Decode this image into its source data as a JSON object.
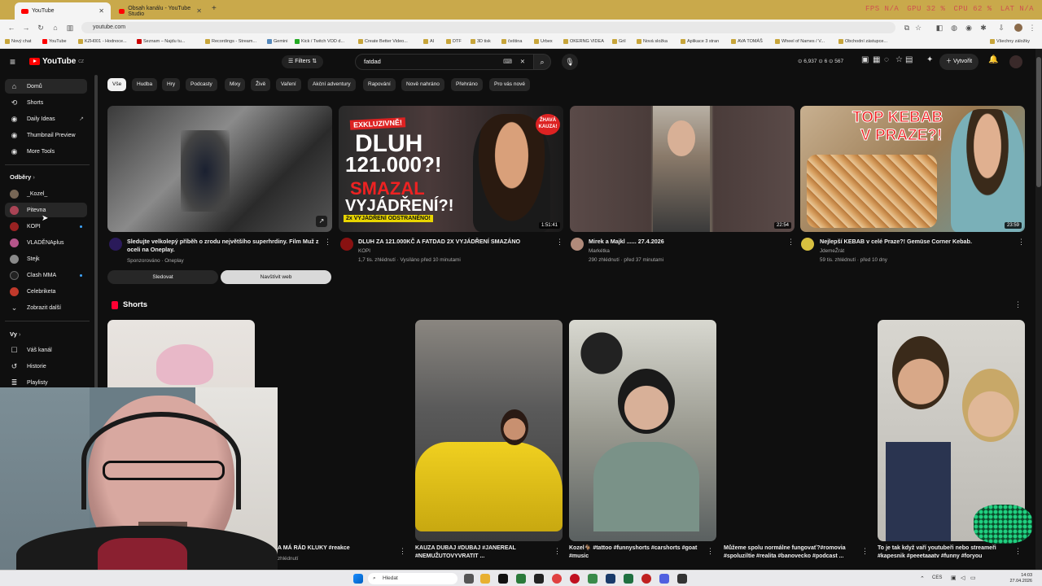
{
  "browser": {
    "tabs": [
      {
        "label": "YouTube",
        "active": true
      },
      {
        "label": "Obsah kanálu - YouTube Studio",
        "active": false
      }
    ],
    "new_tab": "+",
    "sys_stats": [
      "FPS N/A",
      "GPU 32 %",
      "CPU 62 %",
      "LAT N/A"
    ],
    "url": "youtube.com",
    "bookmarks": [
      "Nový chat",
      "YouTube",
      "KZH001 - Hodnoce...",
      "Seznam – Najdu tu...",
      "Recordings - Stream...",
      "Gemini",
      "Kick / Twitch VOD d...",
      "Create Better Video...",
      "AI",
      "DTF",
      "3D tisk",
      "čeština",
      "Urbex",
      "OKERNG VIDEA",
      "Gril",
      "Nová složka",
      "Aplikace 3 stran",
      "AVA TOMÁŠ",
      "Wheel of Names / V...",
      "Obchodní zástupce..."
    ],
    "all_bookmarks": "Všechny záložky"
  },
  "yt": {
    "logo": "YouTube",
    "logo_sup": "CZ",
    "filters_label": "Filters",
    "search_value": "fatdad",
    "header_stats": "⊙ 6,937  ⊙ 6  ⊙ 567",
    "create_label": "Vytvořit"
  },
  "sidebar": {
    "main": [
      {
        "label": "Domů",
        "icon": "home-icon"
      },
      {
        "label": "Shorts",
        "icon": "shorts-icon"
      },
      {
        "label": "Daily Ideas",
        "icon": "daily-ideas-icon"
      },
      {
        "label": "Thumbnail Preview",
        "icon": "thumbnail-preview-icon"
      },
      {
        "label": "More Tools",
        "icon": "more-tools-icon"
      }
    ],
    "subs_header": "Odběry",
    "subs": [
      {
        "label": "_Kozel_"
      },
      {
        "label": "Pitevna"
      },
      {
        "label": "KOPI"
      },
      {
        "label": "VLADĚNAplus"
      },
      {
        "label": "Stejk"
      },
      {
        "label": "Clash MMA"
      },
      {
        "label": "Celebriketa"
      },
      {
        "label": "Zobrazit další"
      }
    ],
    "you_header": "Vy",
    "you": [
      {
        "label": "Váš kanál"
      },
      {
        "label": "Historie"
      },
      {
        "label": "Playlisty"
      }
    ]
  },
  "chips": [
    "Vše",
    "Hudba",
    "Hry",
    "Podcasty",
    "Mixy",
    "Živě",
    "Vaření",
    "Akční adventury",
    "Rapování",
    "Nově nahráno",
    "Přehráno",
    "Pro vás nové"
  ],
  "videos": [
    {
      "title": "Sledujte velkolepý příběh o zrodu největšího superhrdiny. Film Muž z oceli na Oneplay.",
      "channel": "Sponzorováno · Oneplay",
      "meta": "",
      "duration": ""
    },
    {
      "title": "DLUH ZA 121.000KČ A FATDAD 2X VYJÁDŘENÍ SMAZÁNO",
      "channel": "KOPI",
      "meta": "1,7 tis. zhlédnutí · Vysíláno před 10 minutami",
      "duration": "1:51:41"
    },
    {
      "title": "Mirek a Majkl ...... 27.4.2026",
      "channel": "Markétka",
      "meta": "290 zhlédnutí · před 37 minutami",
      "duration": "22:54"
    },
    {
      "title": "Nejlepší KEBAB v celé Praze?! Gemüse Corner Kebab.",
      "channel": "JdemeŽrát",
      "meta": "59 tis. zhlédnutí · před 10 dny",
      "duration": "23:59"
    }
  ],
  "ad_buttons": {
    "watch": "Sledovat",
    "visit": "Navštívit web"
  },
  "thumb_text": {
    "exkluzivne": "EXKLUZIVNĚ!",
    "dluh": "DLUH",
    "amount": "121.000?!",
    "smazal": "SMAZAL",
    "vyjadreni": "VYJÁDŘENÍ?!",
    "odstraneno": "2x VYJÁDŘENÍ ODSTRANĚNO!",
    "horka": "ŽHAVÁ KAUZA!",
    "kebab1": "TOP KEBAB",
    "kebab2": "V PRAZE?!"
  },
  "shorts": {
    "header": "Shorts",
    "items": [
      {
        "title": "A MÁ RÁD KLUKY #reakce",
        "meta": "zhlédnutí"
      },
      {
        "title": "KAUZA DUBAJ #DUBAJ #JANEREAL #NEMUŽUTOVYVRATIT ...",
        "meta": ""
      },
      {
        "title": "Kozel🐐 #tattoo #funnyshorts #carshorts #goat #music",
        "meta": ""
      },
      {
        "title": "Můžeme spolu normálne fungovať?#romovia #spoluziltie #realita #banovecko #podcast ...",
        "meta": ""
      },
      {
        "title": "To je tak když vaří youtubeři nebo streameři #kapesnik #peeetaaatv #funny #foryou",
        "meta": ""
      }
    ]
  },
  "taskbar": {
    "search": "Hledat",
    "lang": "CES",
    "time": "14:03",
    "date": "27.04.2026"
  }
}
